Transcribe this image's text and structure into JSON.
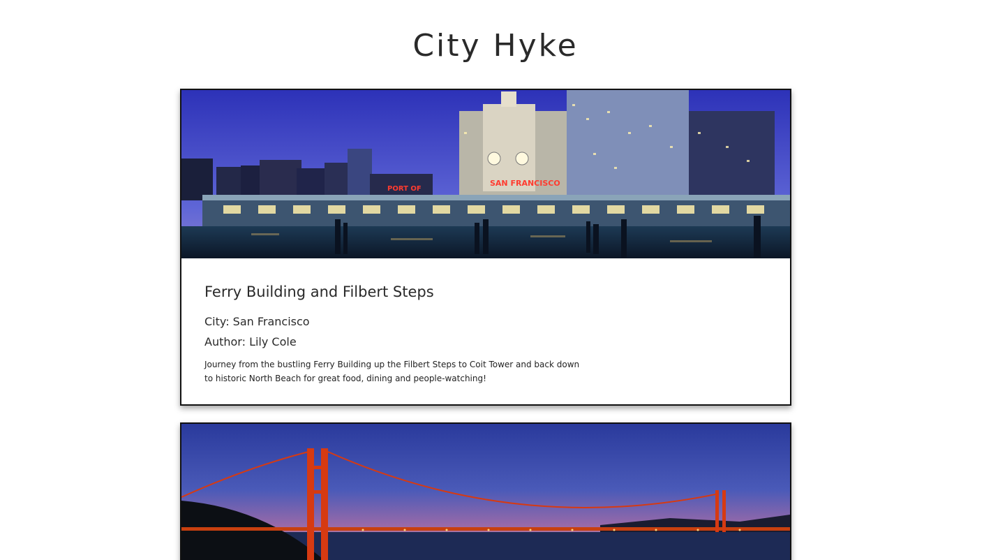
{
  "header": {
    "title": "City Hyke"
  },
  "hykes": [
    {
      "title": "Ferry Building and Filbert Steps",
      "city": "City: San Francisco",
      "author": "Author: Lily Cole",
      "description": "Journey from the bustling Ferry Building up the Filbert Steps to Coit Tower and back down to historic North Beach for great food, dining and people-watching!",
      "image_sign_1": "PORT OF",
      "image_sign_2": "SAN FRANCISCO"
    },
    {
      "title": "",
      "city": "",
      "author": "",
      "description": ""
    }
  ],
  "colors": {
    "sky_top": "#3a3fc0",
    "sky_bottom": "#6a72d8",
    "sign_red": "#ff3b2f",
    "bridge_orange": "#d63a12",
    "border": "#111111"
  }
}
